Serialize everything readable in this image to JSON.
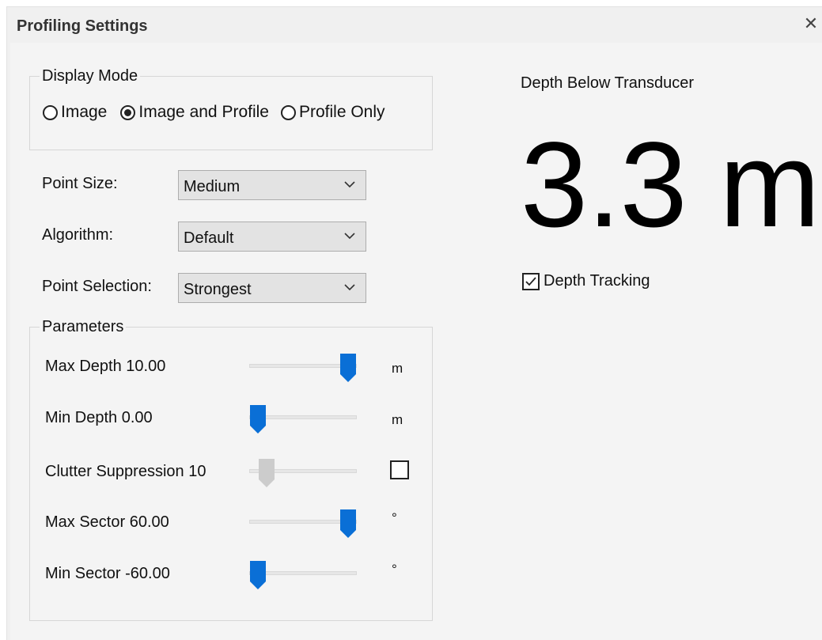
{
  "window": {
    "title": "Profiling Settings",
    "close_glyph": "✕"
  },
  "display_mode": {
    "label": "Display Mode",
    "options": [
      "Image",
      "Image and Profile",
      "Profile Only"
    ],
    "selected": "Image and Profile"
  },
  "settings": {
    "point_size": {
      "label": "Point Size:",
      "value": "Medium"
    },
    "algorithm": {
      "label": "Algorithm:",
      "value": "Default"
    },
    "point_selection": {
      "label": "Point Selection:",
      "value": "Strongest"
    }
  },
  "parameters": {
    "label": "Parameters",
    "rows": [
      {
        "label": "Max Depth 10.00",
        "unit": "m",
        "level": 1.0,
        "enabled": true
      },
      {
        "label": "Min Depth 0.00",
        "unit": "m",
        "level": 0.0,
        "enabled": true
      },
      {
        "label": "Clutter Suppression 10",
        "unit": "",
        "level": 0.1,
        "enabled": false,
        "checkbox_checked": false
      },
      {
        "label": "Max Sector 60.00",
        "unit": "°",
        "level": 1.0,
        "enabled": true
      },
      {
        "label": "Min Sector -60.00",
        "unit": "°",
        "level": 0.0,
        "enabled": true
      }
    ]
  },
  "depth": {
    "title": "Depth Below Transducer",
    "value": "3.3 m",
    "tracking_label": "Depth Tracking",
    "tracking_checked": true
  },
  "colors": {
    "accent": "#0a6fd6",
    "disabled_thumb": "#cccccc"
  },
  "icons": {
    "close": "close-icon",
    "dropdown": "chevron-down-icon",
    "check": "checkmark-icon"
  }
}
